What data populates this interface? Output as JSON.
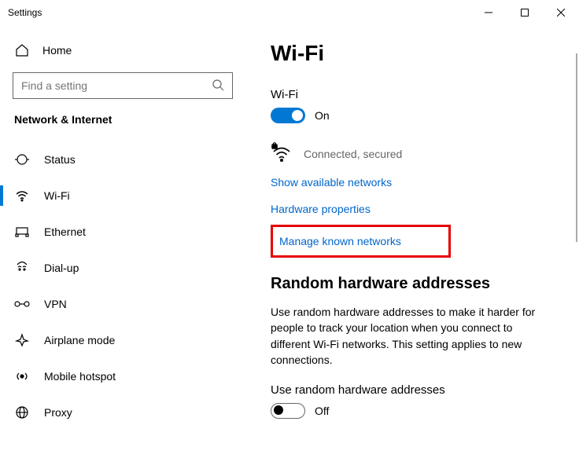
{
  "titlebar": {
    "title": "Settings"
  },
  "sidebar": {
    "home_label": "Home",
    "search_placeholder": "Find a setting",
    "section_title": "Network & Internet",
    "items": [
      {
        "label": "Status"
      },
      {
        "label": "Wi-Fi"
      },
      {
        "label": "Ethernet"
      },
      {
        "label": "Dial-up"
      },
      {
        "label": "VPN"
      },
      {
        "label": "Airplane mode"
      },
      {
        "label": "Mobile hotspot"
      },
      {
        "label": "Proxy"
      }
    ]
  },
  "main": {
    "heading": "Wi-Fi",
    "wifi_label": "Wi-Fi",
    "wifi_toggle_text": "On",
    "status_text": "Connected, secured",
    "link_show_available": "Show available networks",
    "link_hardware_props": "Hardware properties",
    "link_manage_known": "Manage known networks",
    "random_heading": "Random hardware addresses",
    "random_desc": "Use random hardware addresses to make it harder for people to track your location when you connect to different Wi-Fi networks. This setting applies to new connections.",
    "random_toggle_label": "Use random hardware addresses",
    "random_toggle_text": "Off"
  }
}
